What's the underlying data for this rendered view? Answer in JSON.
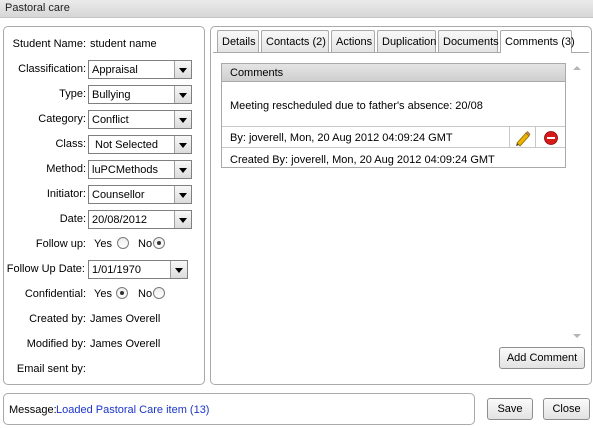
{
  "window": {
    "title": "Pastoral care"
  },
  "form": {
    "student_name": {
      "label": "Student Name:",
      "value": "student name"
    },
    "classification": {
      "label": "Classification:",
      "value": "Appraisal"
    },
    "type": {
      "label": "Type:",
      "value": "Bullying"
    },
    "category": {
      "label": "Category:",
      "value": "Conflict"
    },
    "class": {
      "label": "Class:",
      "value": "Not Selected"
    },
    "method": {
      "label": "Method:",
      "value": "luPCMethods"
    },
    "initiator": {
      "label": "Initiator:",
      "value": "Counsellor"
    },
    "date": {
      "label": "Date:",
      "value": "20/08/2012"
    },
    "follow_up": {
      "label": "Follow up:",
      "yes": "Yes",
      "no": "No",
      "selected": "No"
    },
    "follow_up_date": {
      "label": "Follow Up Date:",
      "value": "1/01/1970"
    },
    "confidential": {
      "label": "Confidential:",
      "yes": "Yes",
      "no": "No",
      "selected": "Yes"
    },
    "created_by": {
      "label": "Created by:",
      "value": "James Overell"
    },
    "modified_by": {
      "label": "Modified by:",
      "value": "James Overell"
    },
    "email_sent_by": {
      "label": "Email sent by:",
      "value": ""
    }
  },
  "tabs": [
    {
      "label": "Details"
    },
    {
      "label": "Contacts (2)"
    },
    {
      "label": "Actions"
    },
    {
      "label": "Duplication"
    },
    {
      "label": "Documents"
    },
    {
      "label": "Comments (3)",
      "active": true
    }
  ],
  "comments": {
    "header": "Comments",
    "text": "Meeting rescheduled due to father's absence: 20/08",
    "by": "By: joverell, Mon, 20 Aug 2012 04:09:24 GMT",
    "created_by": "Created By: joverell, Mon, 20 Aug 2012 04:09:24 GMT",
    "edit_icon": "pencil-icon",
    "delete_icon": "delete-icon",
    "add_label": "Add Comment"
  },
  "footer": {
    "message_label": "Message:",
    "message_text": "Loaded Pastoral Care item (13)",
    "message_color": "#1a35c8",
    "save_label": "Save",
    "close_label": "Close"
  }
}
